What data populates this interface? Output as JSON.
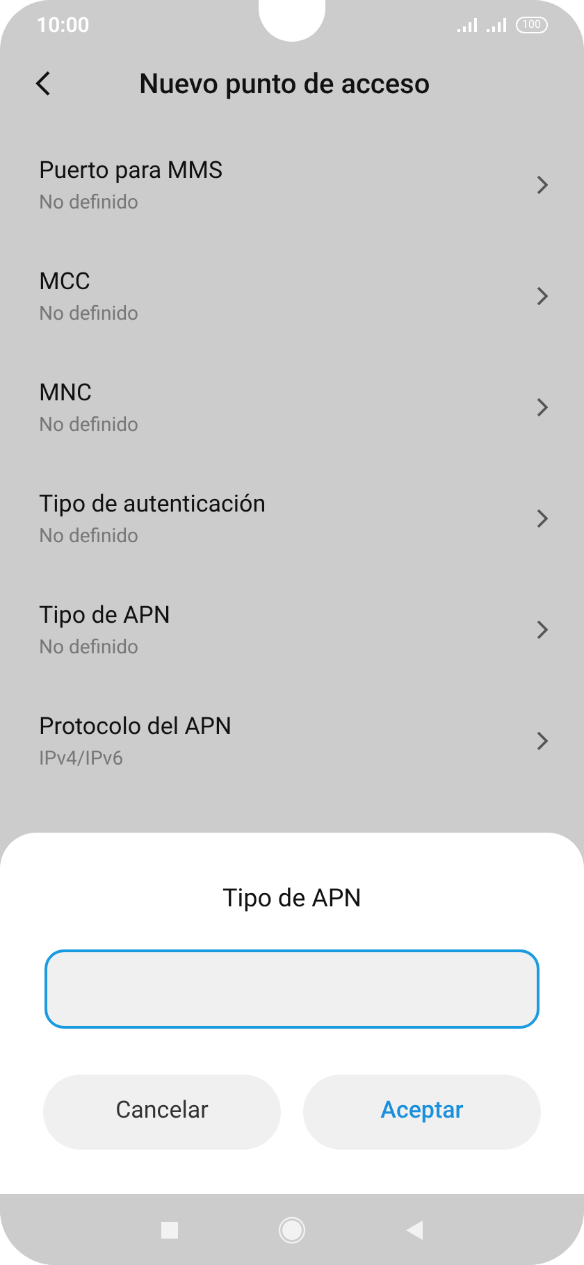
{
  "status_bar": {
    "time": "10:00",
    "battery": "100"
  },
  "header": {
    "title": "Nuevo punto de acceso"
  },
  "settings": [
    {
      "title": "Puerto para MMS",
      "value": "No definido"
    },
    {
      "title": "MCC",
      "value": "No definido"
    },
    {
      "title": "MNC",
      "value": "No definido"
    },
    {
      "title": "Tipo de autenticación",
      "value": "No definido"
    },
    {
      "title": "Tipo de APN",
      "value": "No definido"
    },
    {
      "title": "Protocolo del APN",
      "value": "IPv4/IPv6"
    }
  ],
  "dialog": {
    "title": "Tipo de APN",
    "buttons": [
      {
        "label": "Cancelar",
        "kind": "cancel"
      },
      {
        "label": "Aceptar",
        "kind": "confirm"
      }
    ]
  }
}
